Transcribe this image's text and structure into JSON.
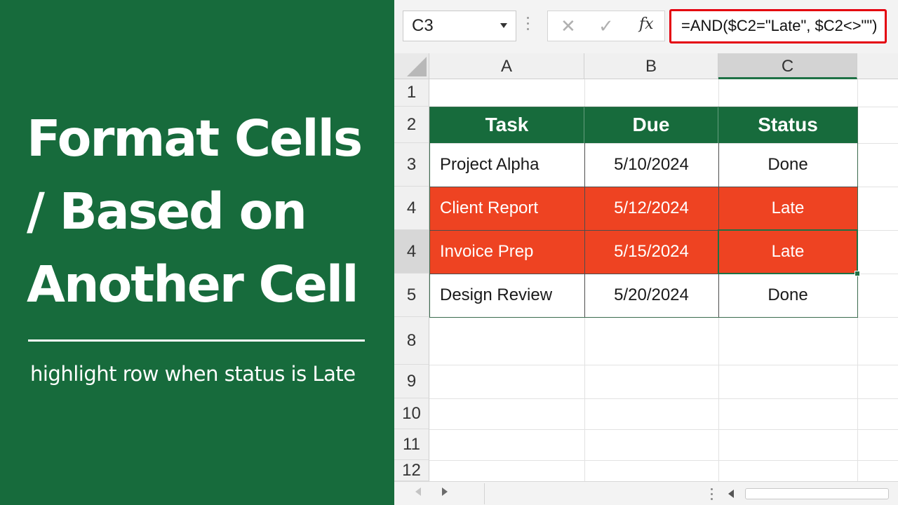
{
  "title": {
    "lines": [
      "Format Cells",
      "/ Based on",
      "Another Cell"
    ],
    "subtitle": "highlight row when status is Late"
  },
  "formula_bar": {
    "name_box": "C3",
    "cancel_icon": "✕",
    "enter_icon": "✓",
    "fx_icon": "fx",
    "formula": "=AND($C2=\"Late\", $C2<>\"\")"
  },
  "sheet": {
    "columns": [
      "A",
      "B",
      "C"
    ],
    "selected_column": "C",
    "row_labels": [
      "1",
      "2",
      "3",
      "4",
      "4",
      "5",
      "8",
      "9",
      "10",
      "11",
      "12"
    ],
    "table": {
      "headers": [
        "Task",
        "Due",
        "Status"
      ],
      "rows": [
        {
          "task": "Project Alpha",
          "due": "5/10/2024",
          "status": "Done"
        },
        {
          "task": "Client Report",
          "due": "5/12/2024",
          "status": "Late"
        },
        {
          "task": "Invoice Prep",
          "due": "5/15/2024",
          "status": "Late"
        },
        {
          "task": "Design Review",
          "due": "5/20/2024",
          "status": "Done"
        }
      ]
    }
  },
  "colors": {
    "brand_green": "#176b3c",
    "late_fill": "#ee4322",
    "formula_highlight": "#e4000f"
  },
  "icons": {
    "name_box_dropdown": "chevron-down-icon",
    "sheet_prev": "triangle-left-icon",
    "sheet_next": "triangle-right-icon",
    "scroll_left": "triangle-left-icon"
  }
}
